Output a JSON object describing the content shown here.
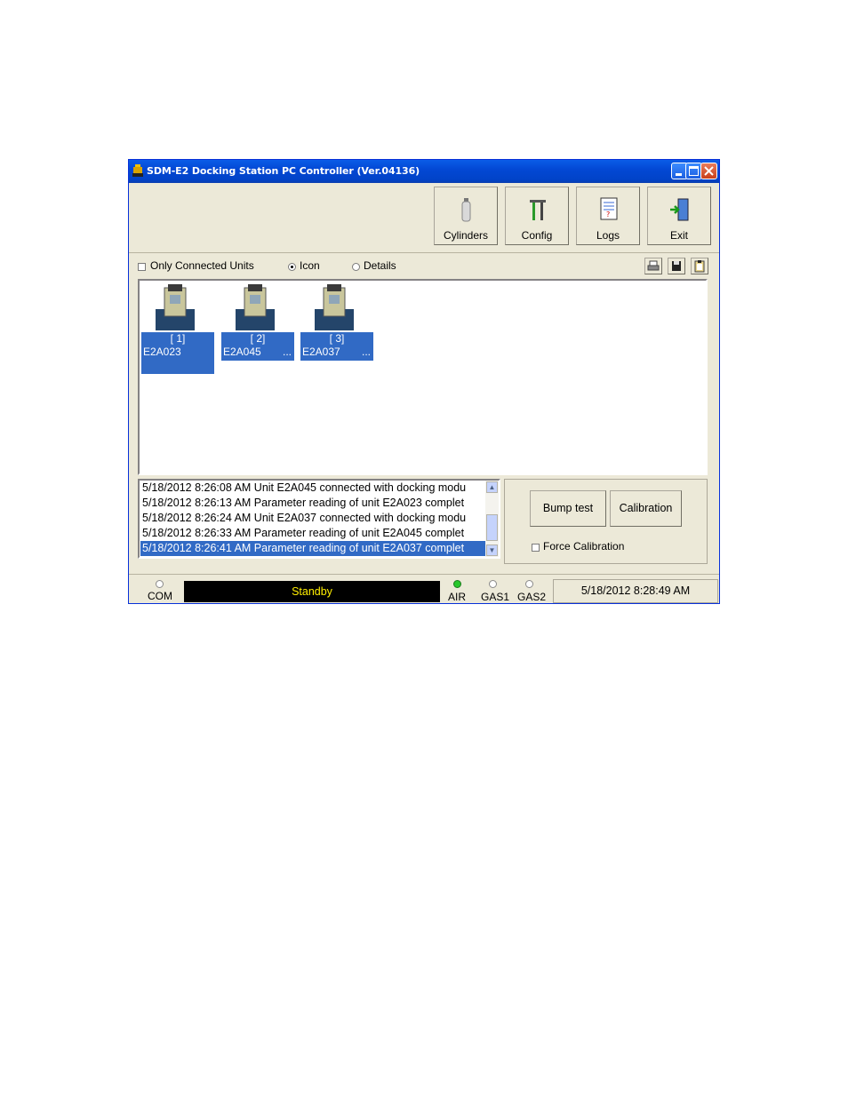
{
  "window": {
    "title": "SDM-E2 Docking Station PC Controller (Ver.04136)"
  },
  "toolbar": {
    "buttons": [
      {
        "label": "Cylinders",
        "icon": "cylinder-icon"
      },
      {
        "label": "Config",
        "icon": "tools-icon"
      },
      {
        "label": "Logs",
        "icon": "log-book-icon"
      },
      {
        "label": "Exit",
        "icon": "exit-door-icon"
      }
    ]
  },
  "options": {
    "only_connected_label": "Only Connected Units",
    "only_connected_checked": false,
    "view_icon_label": "Icon",
    "view_details_label": "Details",
    "selected_view": "Icon"
  },
  "units": [
    {
      "index": "[ 1]",
      "name": "E2A023",
      "more": ""
    },
    {
      "index": "[ 2]",
      "name": "E2A045",
      "more": "..."
    },
    {
      "index": "[ 3]",
      "name": "E2A037",
      "more": "..."
    }
  ],
  "log": [
    "5/18/2012 8:26:08 AM Unit E2A045 connected with docking modu",
    "5/18/2012 8:26:13 AM Parameter reading of unit E2A023 complet",
    "5/18/2012 8:26:24 AM Unit E2A037 connected with docking modu",
    "5/18/2012 8:26:33 AM Parameter reading of unit E2A045 complet",
    "5/18/2012 8:26:41 AM Parameter reading of unit E2A037 complet"
  ],
  "actions": {
    "bump_test_label": "Bump test",
    "calibration_label": "Calibration",
    "force_calibration_label": "Force Calibration",
    "force_calibration_checked": false
  },
  "status": {
    "com_label": "COM",
    "state": "Standby",
    "air_label": "AIR",
    "gas1_label": "GAS1",
    "gas2_label": "GAS2",
    "datetime": "5/18/2012 8:28:49 AM",
    "colors": {
      "air_led": "#27c72b",
      "standby_text": "#ffee00",
      "selection": "#316ac5"
    }
  }
}
